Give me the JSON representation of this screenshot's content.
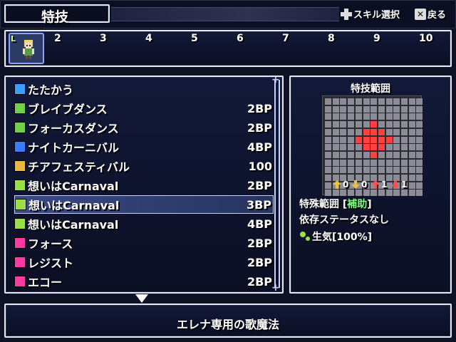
{
  "header": {
    "title": "特技",
    "hint_select": "スキル選択",
    "hint_back": "戻る"
  },
  "party": {
    "level_mark": "L",
    "slots": [
      "2",
      "3",
      "4",
      "5",
      "6",
      "7",
      "8",
      "9",
      "10"
    ]
  },
  "skills": [
    {
      "name": "たたかう",
      "bp": "",
      "icon": "sword-icon",
      "color": "#3aa0ff"
    },
    {
      "name": "ブレイブダンス",
      "bp": "2BP",
      "icon": "dance-plus-icon",
      "color": "#6fd04a"
    },
    {
      "name": "フォーカスダンス",
      "bp": "2BP",
      "icon": "dance-plus-icon",
      "color": "#6fd04a"
    },
    {
      "name": "ナイトカーニバル",
      "bp": "4BP",
      "icon": "square-blue-icon",
      "color": "#3a7cff"
    },
    {
      "name": "チアフェスティバル",
      "bp": "100",
      "icon": "star-gold-icon",
      "color": "#e8b840"
    },
    {
      "name": "想いはCarnaval",
      "bp": "2BP",
      "icon": "note-icon",
      "color": "#9adf4a"
    },
    {
      "name": "想いはCarnaval",
      "bp": "3BP",
      "icon": "note-icon",
      "color": "#9adf4a"
    },
    {
      "name": "想いはCarnaval",
      "bp": "4BP",
      "icon": "note-icon",
      "color": "#9adf4a"
    },
    {
      "name": "フォース",
      "bp": "2BP",
      "icon": "voice-icon",
      "color": "#ff3aa0"
    },
    {
      "name": "レジスト",
      "bp": "2BP",
      "icon": "voice-icon",
      "color": "#ff3aa0"
    },
    {
      "name": "エコー",
      "bp": "2BP",
      "icon": "voice-icon",
      "color": "#ff3aa0"
    }
  ],
  "selected_index": 6,
  "range": {
    "title": "特技範囲",
    "stats": [
      "0",
      "0",
      "1",
      "1"
    ],
    "info_label": "特殊範囲 [",
    "info_value": "補助",
    "info_close": "]",
    "dependency": "依存ステータスなし",
    "effect": "生気[100%]"
  },
  "description": "エレナ専用の歌魔法",
  "colors": {
    "accent": "#c9d0ff",
    "hit": "#ff4040",
    "support": "#7cff7c"
  }
}
